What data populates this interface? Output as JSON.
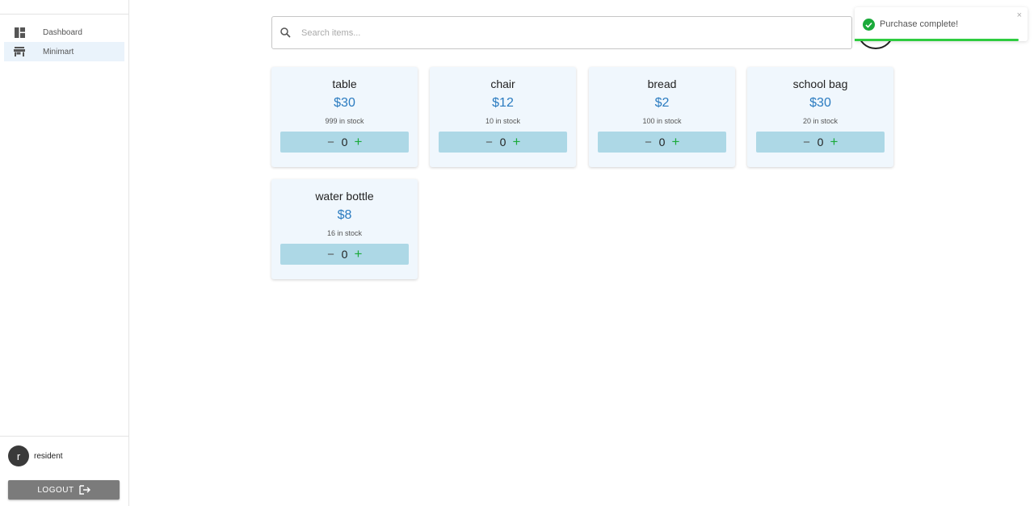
{
  "sidebar": {
    "items": [
      {
        "label": "Dashboard",
        "icon": "dashboard-icon",
        "active": false
      },
      {
        "label": "Minimart",
        "icon": "store-icon",
        "active": true
      }
    ],
    "user": {
      "initial": "r",
      "name": "resident"
    },
    "logout_label": "LOGOUT"
  },
  "search": {
    "placeholder": "Search items..."
  },
  "products": [
    {
      "name": "table",
      "price": "$30",
      "stock": "999 in stock",
      "quantity": "0"
    },
    {
      "name": "chair",
      "price": "$12",
      "stock": "10 in stock",
      "quantity": "0"
    },
    {
      "name": "bread",
      "price": "$2",
      "stock": "100 in stock",
      "quantity": "0"
    },
    {
      "name": "school bag",
      "price": "$30",
      "stock": "20 in stock",
      "quantity": "0"
    },
    {
      "name": "water bottle",
      "price": "$8",
      "stock": "16 in stock",
      "quantity": "0"
    }
  ],
  "qty_controls": {
    "minus": "−",
    "plus": "+"
  },
  "toast": {
    "message": "Purchase complete!",
    "close": "×",
    "progress": 0.95
  },
  "colors": {
    "accent": "#2a7bc0",
    "qty_bg": "#add8e6",
    "success": "#1aaa3a",
    "card_bg": "#f0f7fd"
  }
}
